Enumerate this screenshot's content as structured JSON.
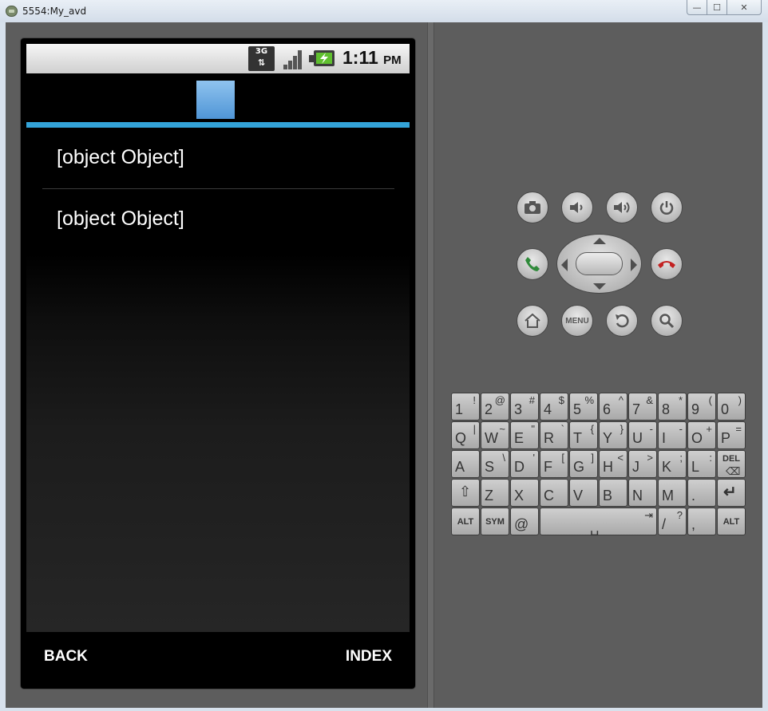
{
  "window": {
    "title": "5554:My_avd",
    "controls": {
      "minimize": "—",
      "maximize": "☐",
      "close": "✕"
    }
  },
  "phone": {
    "statusbar": {
      "network": "3G",
      "time": "1:11",
      "ampm": "PM"
    },
    "list": {
      "items": [
        "[object Object]",
        "[object Object]"
      ]
    },
    "nav": {
      "back": "BACK",
      "index": "INDEX"
    }
  },
  "controls": {
    "menu_label": "MENU",
    "accent_colors": {
      "call": "#2f8a3a",
      "end_call": "#c32222",
      "title_rule": "#33a3d8"
    }
  },
  "keyboard": {
    "rows": [
      [
        [
          "1",
          "!"
        ],
        [
          "2",
          "@"
        ],
        [
          "3",
          "#"
        ],
        [
          "4",
          "$"
        ],
        [
          "5",
          "%"
        ],
        [
          "6",
          "^"
        ],
        [
          "7",
          "&"
        ],
        [
          "8",
          "*"
        ],
        [
          "9",
          "("
        ],
        [
          "0",
          ")"
        ]
      ],
      [
        [
          "Q",
          "|"
        ],
        [
          "W",
          "~"
        ],
        [
          "E",
          "\""
        ],
        [
          "R",
          "`"
        ],
        [
          "T",
          "{"
        ],
        [
          "Y",
          "}"
        ],
        [
          "U",
          "-"
        ],
        [
          "I",
          "-"
        ],
        [
          "O",
          "+"
        ],
        [
          "P",
          "="
        ]
      ],
      [
        [
          "A",
          ""
        ],
        [
          "S",
          "\\"
        ],
        [
          "D",
          "'"
        ],
        [
          "F",
          "["
        ],
        [
          "G",
          "]"
        ],
        [
          "H",
          "<"
        ],
        [
          "J",
          ">"
        ],
        [
          "K",
          ";"
        ],
        [
          "L",
          ":"
        ]
      ],
      [
        [
          "Z",
          ""
        ],
        [
          "X",
          ""
        ],
        [
          "C",
          ""
        ],
        [
          "V",
          ""
        ],
        [
          "B",
          ""
        ],
        [
          "N",
          ""
        ],
        [
          "M",
          ""
        ],
        [
          ".",
          ""
        ]
      ]
    ],
    "del_label": "DEL",
    "alt_label": "ALT",
    "sym_label": "SYM",
    "at_label": "@",
    "slash": [
      "/",
      "?"
    ],
    "comma": ","
  }
}
